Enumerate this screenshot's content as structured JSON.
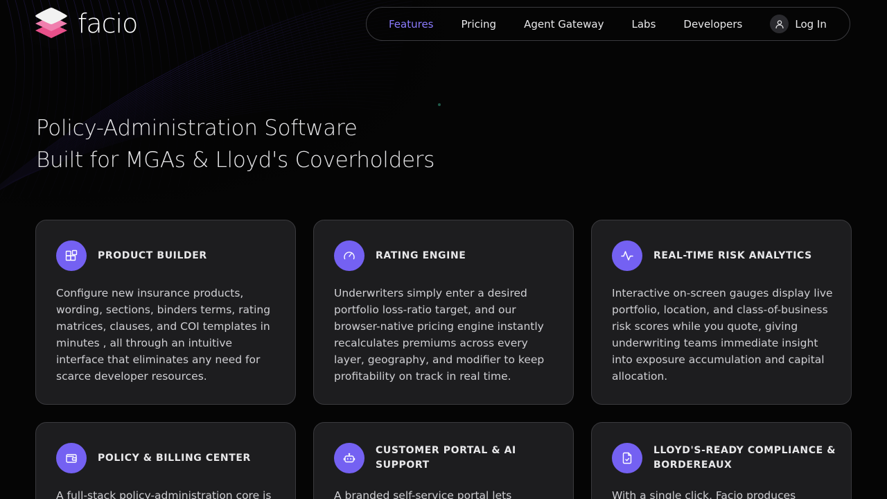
{
  "brand": {
    "name": "facio",
    "accent": "#7461f2",
    "nav_active": "#8b7bff",
    "logo_colors": [
      "#f2f2f2",
      "#f3a6c8",
      "#e8508a"
    ]
  },
  "nav": {
    "items": [
      {
        "label": "Features",
        "active": true
      },
      {
        "label": "Pricing",
        "active": false
      },
      {
        "label": "Agent Gateway",
        "active": false
      },
      {
        "label": "Labs",
        "active": false
      },
      {
        "label": "Developers",
        "active": false
      }
    ],
    "login_label": "Log In",
    "login_icon": "user-icon"
  },
  "hero": {
    "line1": "Policy-Administration Software",
    "line2": "Built for MGAs & Lloyd's Coverholders"
  },
  "cards": [
    {
      "icon": "blocks-icon",
      "title": "PRODUCT BUILDER",
      "description": "Configure new insurance products, wording, sections, binders terms, rating matrices, clauses, and COI templates in minutes , all through an intuitive interface that eliminates any need for scarce developer resources."
    },
    {
      "icon": "gauge-icon",
      "title": "RATING ENGINE",
      "description": "Underwriters simply enter a desired portfolio loss-ratio target, and our browser-native pricing engine instantly recalculates premiums across every layer, geography, and modifier to keep profitability on track in real time."
    },
    {
      "icon": "activity-icon",
      "title": "REAL-TIME RISK ANALYTICS",
      "description": "Interactive on-screen gauges display live portfolio, location, and class-of-business risk scores while you quote, giving underwriting teams immediate insight into exposure accumulation and capital allocation."
    },
    {
      "icon": "wallet-icon",
      "title": "POLICY & BILLING CENTER",
      "description": "A full-stack policy-administration core is"
    },
    {
      "icon": "bot-icon",
      "title": "CUSTOMER PORTAL & AI SUPPORT",
      "description": "A branded self-service portal lets insureds"
    },
    {
      "icon": "document-check-icon",
      "title": "LLOYD'S-READY COMPLIANCE & BORDEREAUX",
      "description": "With a single click, Facio produces"
    }
  ]
}
